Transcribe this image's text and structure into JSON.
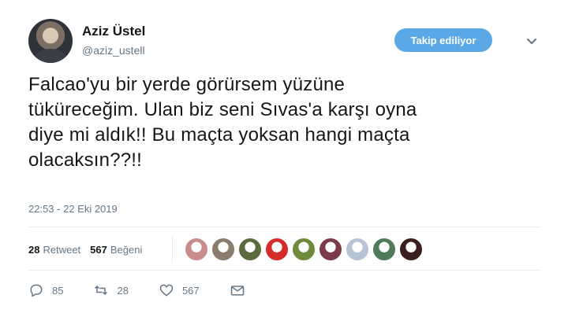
{
  "user": {
    "name": "Aziz Üstel",
    "handle": "@aziz_ustell"
  },
  "follow_button": {
    "label": "Takip ediliyor",
    "color": "#5ba8e6"
  },
  "tweet": {
    "lines": [
      "Falcao'yu bir yerde görürsem yüzüne",
      "tükürece­ğim. Ulan biz seni Sıvas'a karşı oyna",
      "diye mi aldık!! Bu maçta yoksan hangi maçta",
      "olacaksın??!!"
    ],
    "timestamp": "22:53 - 22 Eki 2019"
  },
  "stats": {
    "retweets_count": "28",
    "retweets_label": "Retweet",
    "likes_count": "567",
    "likes_label": "Beğeni"
  },
  "likers": [
    {
      "color": "#c98c8c"
    },
    {
      "color": "#8a7d6e"
    },
    {
      "color": "#5a6b3e"
    },
    {
      "color": "#d62b2b"
    },
    {
      "color": "#6f8a3a"
    },
    {
      "color": "#7c3b4a"
    },
    {
      "color": "#b7c4d6"
    },
    {
      "color": "#4f7b5a"
    },
    {
      "color": "#3a1f1f"
    }
  ],
  "actions": {
    "replies": "85",
    "retweets": "28",
    "likes": "567"
  }
}
